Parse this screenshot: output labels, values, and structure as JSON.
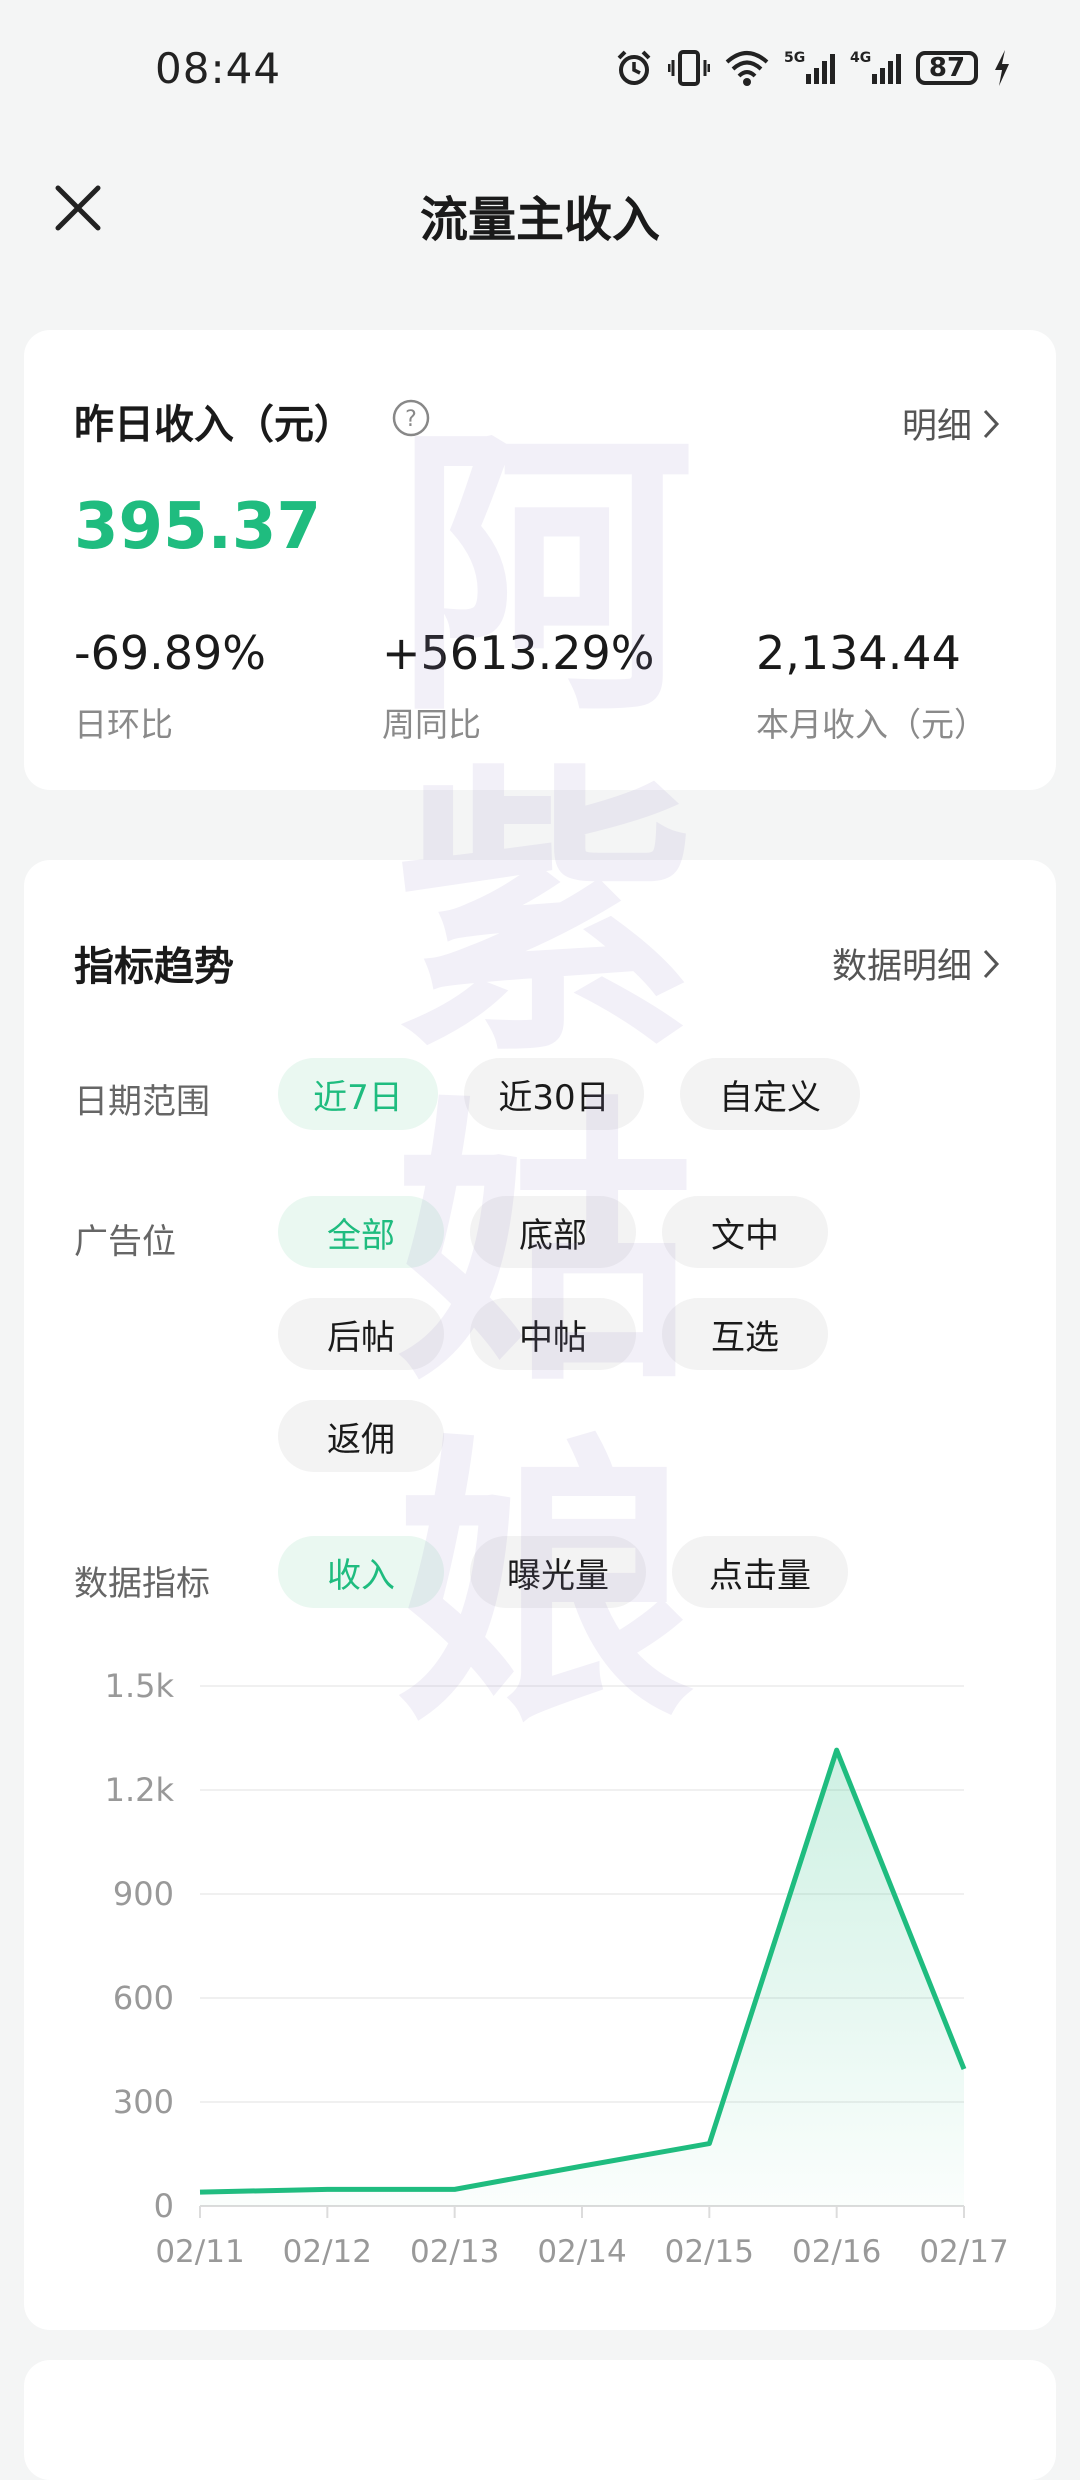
{
  "status_bar": {
    "time": "08:44",
    "battery": "87",
    "net1": "5G",
    "net2": "4G"
  },
  "header": {
    "title": "流量主收入"
  },
  "summary": {
    "title": "昨日收入（元）",
    "detail_link": "明细",
    "yesterday_income": "395.37",
    "stats": [
      {
        "value": "-69.89%",
        "label": "日环比"
      },
      {
        "value": "+5613.29%",
        "label": "周同比"
      },
      {
        "value": "2,134.44",
        "label": "本月收入（元）"
      }
    ]
  },
  "trend": {
    "title": "指标趋势",
    "detail_link": "数据明细",
    "date_range": {
      "label": "日期范围",
      "options": [
        "近7日",
        "近30日",
        "自定义"
      ],
      "selected": "近7日"
    },
    "ad_slot": {
      "label": "广告位",
      "options": [
        "全部",
        "底部",
        "文中",
        "后帖",
        "中帖",
        "互选",
        "返佣"
      ],
      "selected": "全部"
    },
    "metric": {
      "label": "数据指标",
      "options": [
        "收入",
        "曝光量",
        "点击量"
      ],
      "selected": "收入"
    }
  },
  "watermark": "阿紫姑娘",
  "colors": {
    "accent": "#1fbc7f",
    "chip_bg": "#f3f3f3",
    "chip_active_bg": "#eaf8f1"
  },
  "chart_data": {
    "type": "area",
    "x": [
      "02/11",
      "02/12",
      "02/13",
      "02/14",
      "02/15",
      "02/16",
      "02/17"
    ],
    "y_ticks": [
      "0",
      "300",
      "600",
      "900",
      "1.2k",
      "1.5k"
    ],
    "ylim": [
      0,
      1500
    ],
    "series": [
      {
        "values": [
          40,
          48,
          48,
          115,
          180,
          1315,
          395
        ]
      }
    ],
    "grid": true
  }
}
